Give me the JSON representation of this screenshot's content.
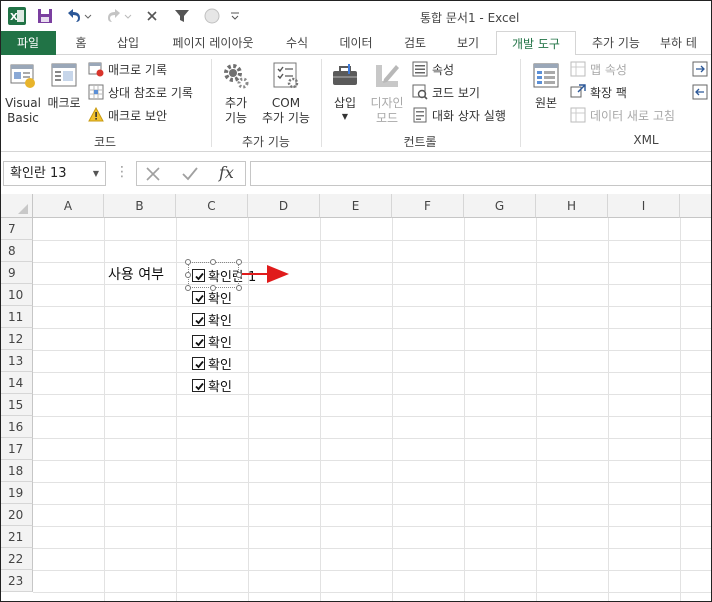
{
  "window": {
    "title": "통합 문서1 - Excel"
  },
  "ribbon_tabs": {
    "file": "파일",
    "home": "홈",
    "insert": "삽입",
    "page_layout": "페이지 레이아웃",
    "formulas": "수식",
    "data": "데이터",
    "review": "검토",
    "view": "보기",
    "developer": "개발 도구",
    "addins": "추가 기능",
    "load_test": "부하 테"
  },
  "ribbon": {
    "code": {
      "visual_basic_line1": "Visual",
      "visual_basic_line2": "Basic",
      "macros": "매크로",
      "record_macro": "매크로 기록",
      "relative_refs": "상대 참조로 기록",
      "macro_security": "매크로 보안",
      "group_label": "코드"
    },
    "addins": {
      "addins_line1": "추가",
      "addins_line2": "기능",
      "com_line1": "COM",
      "com_line2": "추가 기능",
      "group_label": "추가 기능"
    },
    "controls": {
      "insert": "삽입",
      "design_line1": "디자인",
      "design_line2": "모드",
      "properties": "속성",
      "view_code": "코드 보기",
      "run_dialog": "대화 상자 실행",
      "group_label": "컨트롤"
    },
    "xml": {
      "source": "원본",
      "map_properties": "맵 속성",
      "expansion_packs": "확장 팩",
      "refresh_data": "데이터 새로 고침",
      "group_label": "XML"
    }
  },
  "formula_bar": {
    "name_box": "확인란 13",
    "fx": "fx",
    "value": ""
  },
  "columns": [
    "A",
    "B",
    "C",
    "D",
    "E",
    "F",
    "G",
    "H",
    "I"
  ],
  "rows": [
    "7",
    "8",
    "9",
    "10",
    "11",
    "12",
    "13",
    "14",
    "15",
    "16",
    "17",
    "18",
    "19",
    "20",
    "21",
    "22",
    "23"
  ],
  "cells": {
    "B9": "사용 여부"
  },
  "checkboxes": [
    {
      "label": "확인란 1",
      "checked": true
    },
    {
      "label": "확인",
      "checked": true
    },
    {
      "label": "확인",
      "checked": true
    },
    {
      "label": "확인",
      "checked": true
    },
    {
      "label": "확인",
      "checked": true
    },
    {
      "label": "확인",
      "checked": true
    }
  ],
  "colors": {
    "excel_green": "#217346",
    "annotation_arrow": "#e01b1b"
  }
}
